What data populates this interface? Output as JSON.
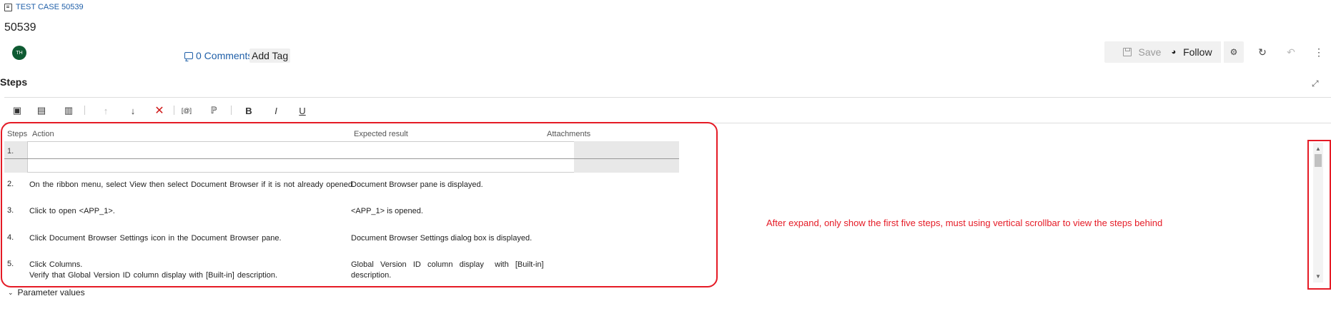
{
  "breadcrumb": {
    "icon": "test-case-icon",
    "label": "TEST CASE 50539"
  },
  "title": "50539",
  "avatar": {
    "initials": "TH",
    "color": "#0e5a32"
  },
  "comments": {
    "icon": "comment-icon",
    "label": "0 Comments"
  },
  "add_tag": "Add Tag",
  "header_actions": {
    "save": "Save",
    "follow": "Follow",
    "icons": [
      "save-icon",
      "eye-icon",
      "gear-icon",
      "refresh-icon",
      "undo-icon",
      "more-icon"
    ]
  },
  "steps": {
    "title": "Steps",
    "toolbar_icons": [
      "insert-step-icon",
      "insert-shared-steps-icon",
      "create-shared-steps-icon",
      "move-up-icon",
      "move-down-icon",
      "delete-icon",
      "parameter-icon",
      "attachment-icon",
      "bold-icon",
      "italic-icon",
      "underline-icon"
    ],
    "columns": {
      "steps": "Steps",
      "action": "Action",
      "expected": "Expected result",
      "attachments": "Attachments"
    },
    "rows": [
      {
        "num": "1.",
        "action": "",
        "expected": ""
      },
      {
        "num": "2.",
        "action": "On the  ribbon menu, select View then select Document Browser if it is not already  opened.",
        "expected": "Document Browser pane is  displayed."
      },
      {
        "num": "3.",
        "action": "Click to  open <APP_1>.",
        "expected": "<APP_1> is opened."
      },
      {
        "num": "4.",
        "action": "Click  Document Browser Settings icon in the Document Browser pane.",
        "expected": "Document Browser Settings dialog  box is displayed."
      },
      {
        "num": "5.",
        "action_line1": "Click  Columns.",
        "action_line2": "Verify that Global Version ID column display with [Built-in]  description.",
        "expected_line1": "Global   Version   ID   column   display     with   [Built-in]",
        "expected_line2": "description."
      }
    ]
  },
  "annotation": {
    "text": "After expand, only show the first five steps, must using vertical scrollbar to view the steps behind",
    "color": "#e51a25"
  },
  "parameter_values": "Parameter values"
}
